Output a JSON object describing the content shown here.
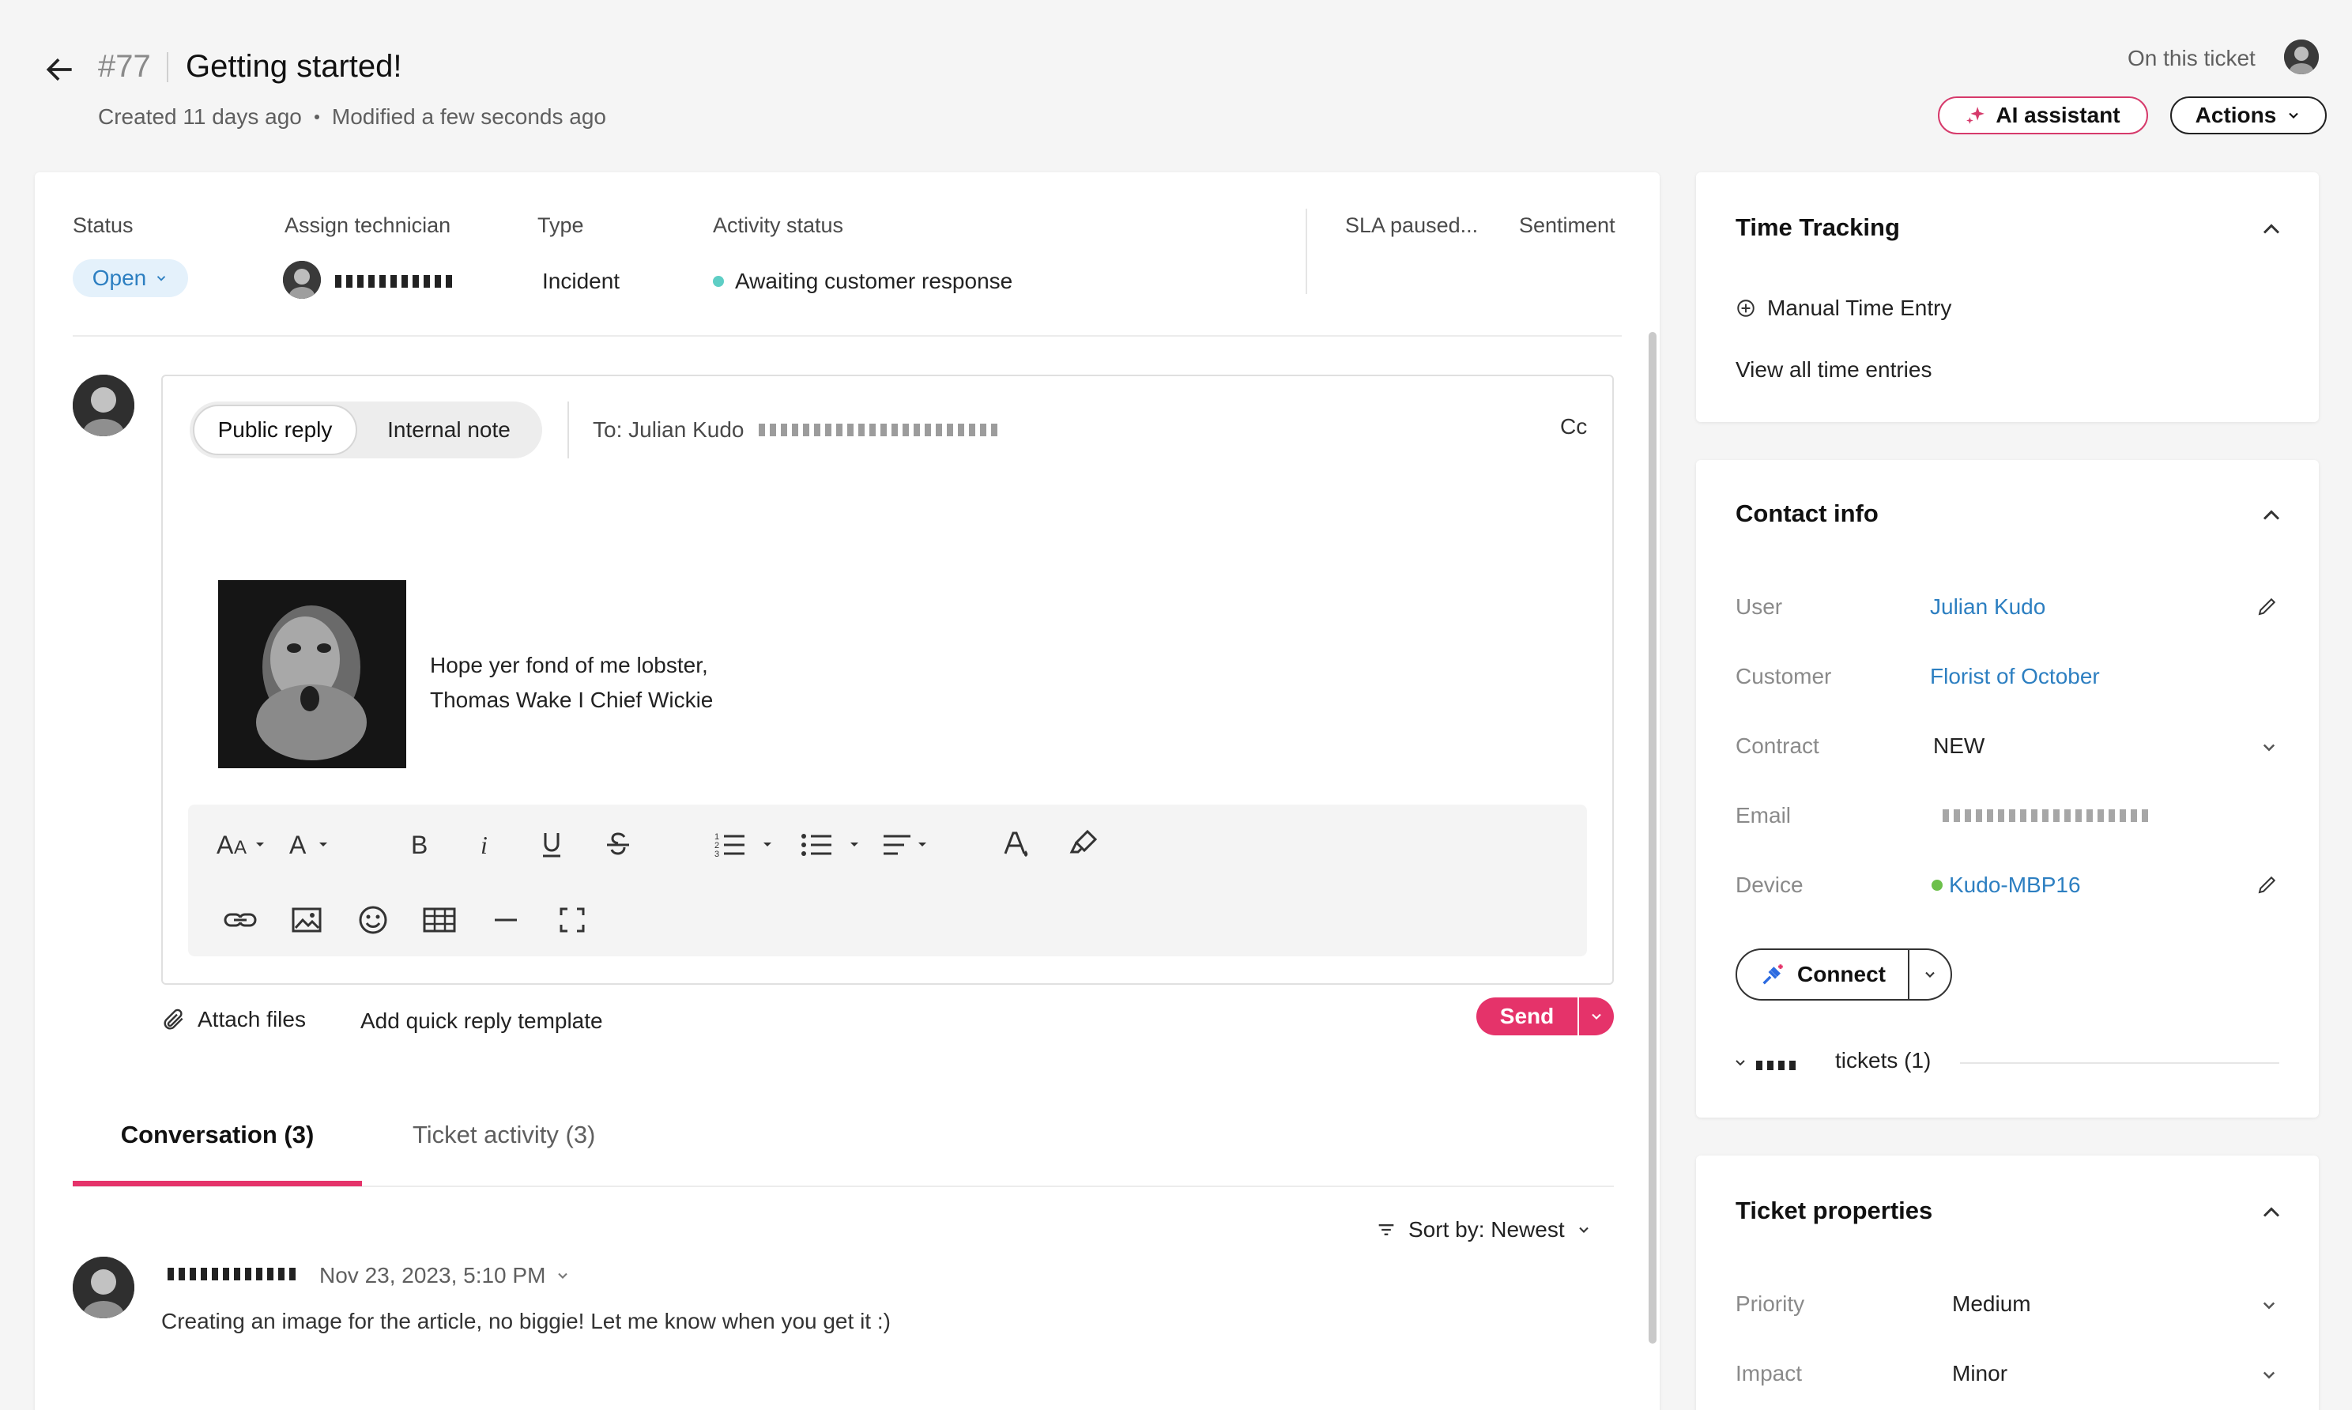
{
  "header": {
    "ticket_number": "#77",
    "title": "Getting started!",
    "created": "Created 11 days ago",
    "modified": "Modified a few seconds ago",
    "on_this_ticket": "On this ticket",
    "ai_assistant_label": "AI assistant",
    "actions_label": "Actions"
  },
  "details": {
    "status_label": "Status",
    "status_value": "Open",
    "assign_label": "Assign technician",
    "type_label": "Type",
    "type_value": "Incident",
    "activity_label": "Activity status",
    "activity_value": "Awaiting customer response",
    "sla_label": "SLA paused...",
    "sentiment_label": "Sentiment",
    "activity_color": "#5ecec5"
  },
  "editor": {
    "public_reply": "Public reply",
    "internal_note": "Internal note",
    "to_prefix": "To: Julian Kudo",
    "cc": "Cc",
    "signature_line1": "Hope yer fond of me lobster,",
    "signature_line2": "Thomas Wake I Chief Wickie",
    "toolbar_icons": [
      "font-size-icon",
      "font-color-icon",
      "bold-icon",
      "italic-icon",
      "underline-icon",
      "strikethrough-icon",
      "numbered-list-icon",
      "bulleted-list-icon",
      "align-icon",
      "text-color-icon",
      "highlight-icon",
      "link-icon",
      "image-icon",
      "emoji-icon",
      "table-icon",
      "horizontal-rule-icon",
      "fullscreen-icon"
    ]
  },
  "footer": {
    "attach_files": "Attach files",
    "quick_reply": "Add quick reply template",
    "send": "Send",
    "send_color": "#e5336a"
  },
  "tabs": {
    "conversation": "Conversation (3)",
    "activity": "Ticket activity (3)"
  },
  "conversation": {
    "sort_label": "Sort by: Newest",
    "messages": [
      {
        "date": "Nov 23, 2023, 5:10 PM",
        "body": "Creating an image for the article, no biggie! Let me know when you get it :)"
      }
    ]
  },
  "time_tracking": {
    "title": "Time Tracking",
    "manual_entry": "Manual Time Entry",
    "view_all": "View all time entries"
  },
  "contact_info": {
    "title": "Contact info",
    "user_label": "User",
    "user_value": "Julian Kudo",
    "customer_label": "Customer",
    "customer_value": "Florist of October",
    "contract_label": "Contract",
    "contract_value": "NEW",
    "email_label": "Email",
    "device_label": "Device",
    "device_value": "Kudo-MBP16",
    "device_status_color": "#6cc04a",
    "connect_label": "Connect",
    "tickets_label": "tickets (1)"
  },
  "ticket_properties": {
    "title": "Ticket properties",
    "priority_label": "Priority",
    "priority_value": "Medium",
    "impact_label": "Impact",
    "impact_value": "Minor"
  }
}
